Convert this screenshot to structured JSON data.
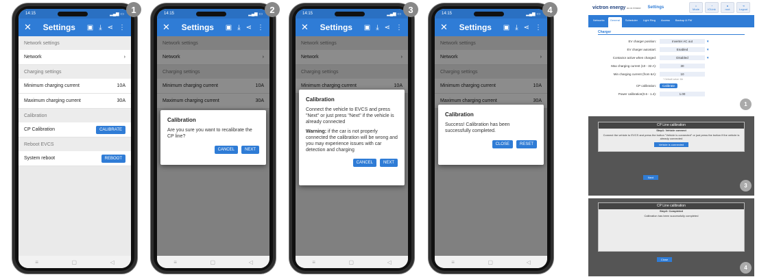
{
  "phones": [
    {
      "number": "1",
      "time": "14:15",
      "title": "Settings"
    },
    {
      "number": "2",
      "time": "14:15",
      "title": "Settings"
    },
    {
      "number": "3",
      "time": "14:15",
      "title": "Settings"
    },
    {
      "number": "4",
      "time": "14:15",
      "title": "Settings"
    }
  ],
  "settings": {
    "network_header": "Network settings",
    "network": "Network",
    "charging_header": "Charging settings",
    "min_current": "Minimum charging current",
    "min_value": "10A",
    "max_current": "Maximum charging current",
    "max_value": "30A",
    "calibration_header": "Calibration",
    "cp_calibration": "CP Calibration",
    "calibrate_btn": "CALIBRATE",
    "reboot_header": "Reboot EVCS",
    "system_reboot": "System reboot",
    "reboot_btn": "REBOOT"
  },
  "dialogs": {
    "d2": {
      "title": "Calibration",
      "text": "Are you sure you want to recalibrate the CP line?",
      "cancel": "CANCEL",
      "next": "NEXT"
    },
    "d3": {
      "title": "Calibration",
      "text": "Connect the vehicle to EVCS and press \"Next\" or just press \"Next\" if the vehicle is already connected",
      "warning_label": "Warning:",
      "warning_text": " if the car is not properly connected the calibration will be wrong and you may experience issues with car detection and charging",
      "cancel": "CANCEL",
      "next": "NEXT"
    },
    "d4": {
      "title": "Calibration",
      "text": "Success! Calibration has been successfully completed.",
      "close": "CLOSE",
      "reset": "RESET"
    }
  },
  "web": {
    "logo": "victron energy",
    "tagline": "BLUE POWER",
    "page": "Settings",
    "top_icons": [
      "Mode",
      "IOLink",
      "root",
      "Logout"
    ],
    "tabs": [
      "Networks",
      "General",
      "Scheduler",
      "Light Ring",
      "Access",
      "Backup & FW"
    ],
    "active_tab": "General",
    "section": "Charger",
    "fields": [
      {
        "label": "EV charger position:",
        "value": "Inverter AC out"
      },
      {
        "label": "EV charger autostart:",
        "value": "Enabled"
      },
      {
        "label": "Contactor active when charged:",
        "value": "Disabled"
      },
      {
        "label": "Max charging current (10 - 32 A):",
        "value": "30"
      },
      {
        "label": "Min charging current (from 6A):",
        "value": "10"
      }
    ],
    "hint": "* Default value: 6A",
    "cp_label": "CP calibration:",
    "cp_button": "Calibrate",
    "power_label": "Power calibration(0.6 - 1.4):",
    "power_value": "1.00",
    "overlay3_title": "CP Line calibration",
    "overlay3_step": "Step1: Vehicle connect",
    "overlay3_text": "Connect the vehicle to EVCS and press the button \"Vehicle is connected\" or just press the button if the vehicle is already connected",
    "overlay3_btn": "Vehicle is connected",
    "overlay3_next": "Next",
    "overlay4_title": "CP Line calibration",
    "overlay4_step": "Step3: Completed",
    "overlay4_text": "Calibration has been successfully completed",
    "overlay4_btn": "Close",
    "badges": [
      "1",
      "3",
      "4"
    ]
  }
}
